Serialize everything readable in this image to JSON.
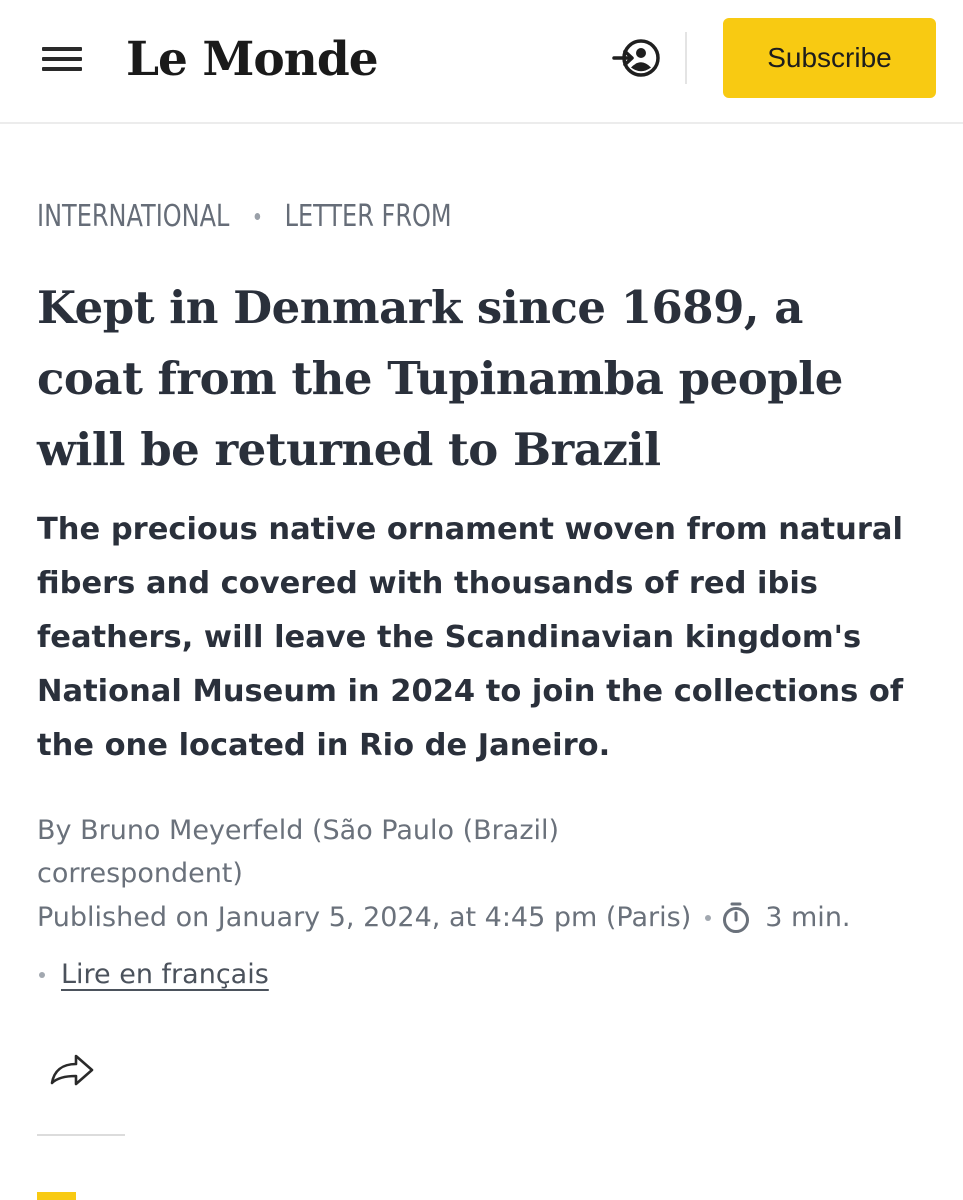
{
  "header": {
    "menu_icon": "hamburger-icon",
    "logo_text": "Le Monde",
    "login_icon": "login-icon",
    "subscribe_label": "Subscribe",
    "accent_color": "#f8ca12"
  },
  "article": {
    "kicker": {
      "section": "INTERNATIONAL",
      "rubric": "LETTER FROM"
    },
    "headline_lines": [
      "Kept in Denmark since 1689, a",
      "coat from the Tupinamba people",
      "will be returned to Brazil"
    ],
    "dek_lines": [
      "The precious native ornament woven from natural",
      "fibers and covered with thousands of red ibis",
      "feathers, will leave the Scandinavian kingdom's",
      "National Museum in 2024 to join the collections of",
      "the one located in Rio de Janeiro."
    ],
    "byline_lines": [
      "By Bruno Meyerfeld  (São Paulo (Brazil)",
      "correspondent)"
    ],
    "published": "Published on January 5, 2024, at 4:45 pm (Paris)",
    "reading_time": "3 min.",
    "reading_time_icon": "timer-icon",
    "lang_link": "Lire en français",
    "share_icon": "share-icon"
  }
}
